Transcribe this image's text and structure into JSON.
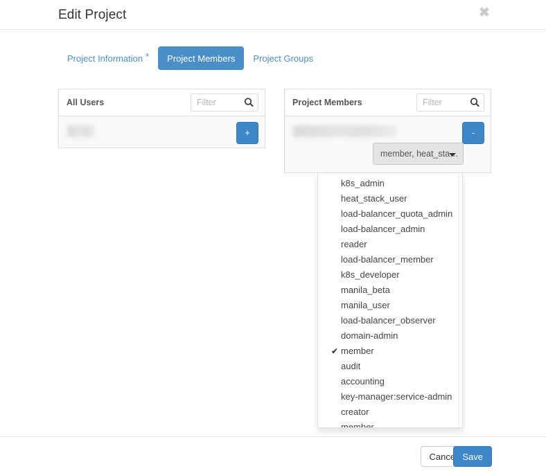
{
  "modal": {
    "title": "Edit Project",
    "close_icon": "close-icon",
    "close_label": "✖"
  },
  "tabs": [
    {
      "label": "Project Information",
      "required_marker": "*",
      "active": false,
      "name": "tab-project-information"
    },
    {
      "label": "Project Members",
      "required_marker": "",
      "active": true,
      "name": "tab-project-members"
    },
    {
      "label": "Project Groups",
      "required_marker": "",
      "active": false,
      "name": "tab-project-groups"
    }
  ],
  "all_users_panel": {
    "title": "All Users",
    "filter": {
      "value": "",
      "placeholder": "Filter"
    },
    "search_icon": "search-icon",
    "rows": [
      {
        "name_redacted": true,
        "action_label": "+",
        "action_name": "add-user-button"
      }
    ]
  },
  "project_members_panel": {
    "title": "Project Members",
    "filter": {
      "value": "",
      "placeholder": "Filter"
    },
    "search_icon": "search-icon",
    "rows": [
      {
        "name_redacted": true,
        "action_label": "-",
        "action_name": "remove-member-button",
        "roles_select_label": "member, heat_sta…"
      }
    ]
  },
  "role_dropdown": {
    "open": true,
    "checked_role": "member",
    "check_glyph": "✔",
    "items": [
      {
        "label": "k8s_admin",
        "checked": false
      },
      {
        "label": "heat_stack_user",
        "checked": false
      },
      {
        "label": "load-balancer_quota_admin",
        "checked": false
      },
      {
        "label": "load-balancer_admin",
        "checked": false
      },
      {
        "label": "reader",
        "checked": false
      },
      {
        "label": "load-balancer_member",
        "checked": false
      },
      {
        "label": "k8s_developer",
        "checked": false
      },
      {
        "label": "manila_beta",
        "checked": false
      },
      {
        "label": "manila_user",
        "checked": false
      },
      {
        "label": "load-balancer_observer",
        "checked": false
      },
      {
        "label": "domain-admin",
        "checked": false
      },
      {
        "label": "member",
        "checked": true
      },
      {
        "label": "audit",
        "checked": false
      },
      {
        "label": "accounting",
        "checked": false
      },
      {
        "label": "key-manager:service-admin",
        "checked": false
      },
      {
        "label": "creator",
        "checked": false
      },
      {
        "label": "member",
        "checked": false
      }
    ]
  },
  "footer": {
    "cancel_label": "Cancel",
    "save_label": "Save"
  },
  "colors": {
    "accent_blue": "#3d87c8",
    "tab_active_blue": "#4b8fc9",
    "link_blue": "#4b8fc9",
    "panel_border": "#dddddd",
    "row_background": "#f9f9f9"
  }
}
